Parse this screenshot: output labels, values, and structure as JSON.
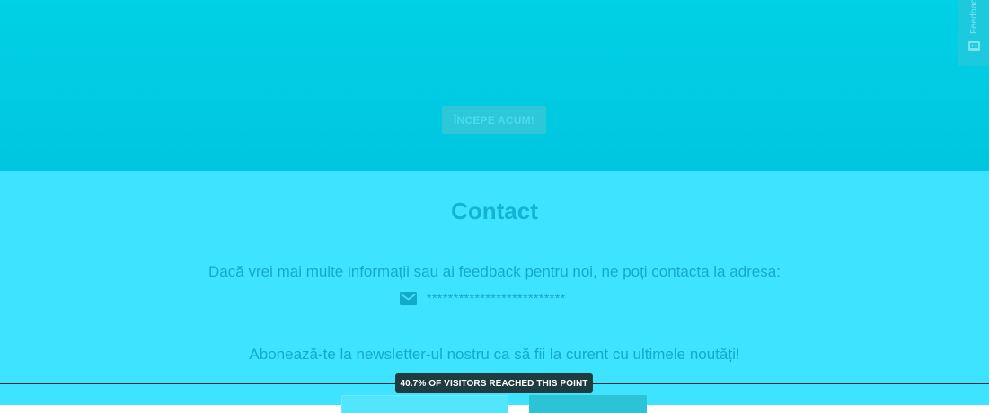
{
  "hero": {
    "cta_label": "ÎNCEPE ACUM!"
  },
  "feedback_tab": {
    "label": "Feedback",
    "icon": "feedback-icon"
  },
  "contact": {
    "title": "Contact",
    "description": "Dacă vrei mai multe informații sau ai feedback pentru noi, ne poți contacta la adresa:",
    "email_icon": "mail-icon",
    "email": "**************************",
    "newsletter_text": "Abonează-te la newsletter-ul nostru ca să fii la curent cu ultimele noutăți!"
  },
  "overlay": {
    "reach_label": "40.7% OF VISITORS REACHED THIS POINT"
  },
  "colors": {
    "hero_bg": "#00cee3",
    "section_bg": "#3ee3ff",
    "text": "#13aac9",
    "badge_bg": "#1e3b3f"
  }
}
